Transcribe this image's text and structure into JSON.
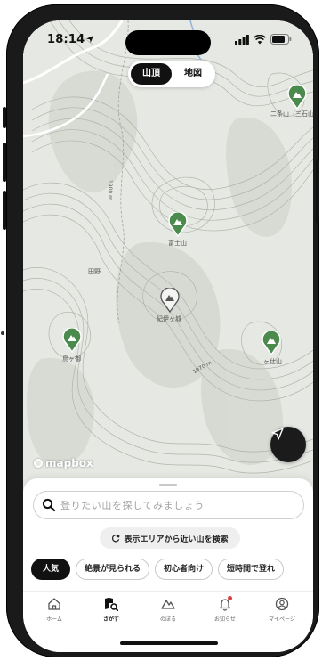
{
  "status_bar": {
    "time": "18:14"
  },
  "map_toggle": {
    "mountains": "山頂",
    "map": "地図"
  },
  "pins": [
    {
      "label": "二条山（三石山）"
    },
    {
      "label": "富士山"
    },
    {
      "label": "紀伊ヶ城"
    },
    {
      "label": "鳥ヶ御"
    },
    {
      "label": "ヶ仕山"
    }
  ],
  "map_labels": {
    "place": "田野",
    "elev1": "1900 m",
    "elev2": "1970 m"
  },
  "mapbox": {
    "logo_text": "mapbox"
  },
  "search": {
    "placeholder": "登りたい山を探してみましょう"
  },
  "area_search_button": {
    "label": "表示エリアから近い山を検索"
  },
  "chips": [
    "人気",
    "絶景が見られる",
    "初心者向け",
    "短時間で登れ"
  ],
  "tabs": [
    {
      "label": "ホーム",
      "icon": "home-icon"
    },
    {
      "label": "さがす",
      "icon": "map-search-icon"
    },
    {
      "label": "のぼる",
      "icon": "mountain-icon"
    },
    {
      "label": "お知らせ",
      "icon": "bell-icon"
    },
    {
      "label": "マイページ",
      "icon": "user-icon"
    }
  ],
  "colors": {
    "pin_green": "#4a8a4c",
    "accent": "#111111",
    "badge": "#e23b3b"
  }
}
